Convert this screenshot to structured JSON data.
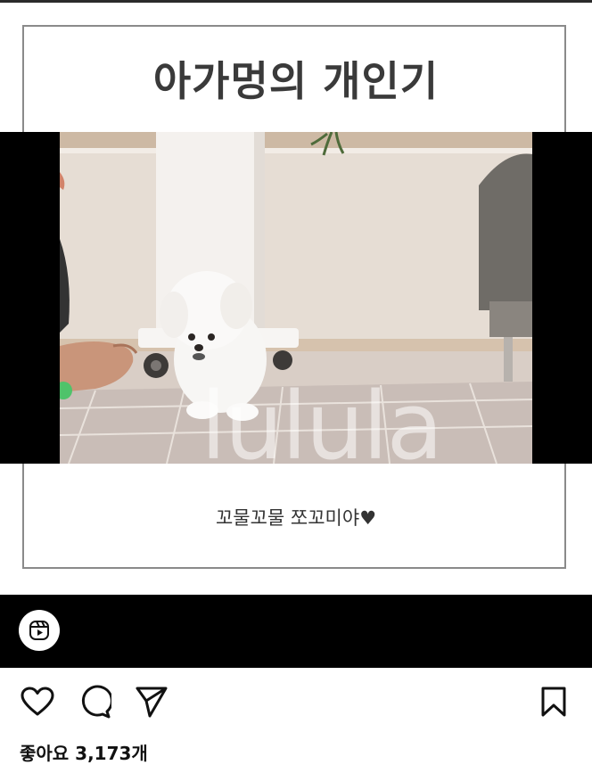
{
  "post": {
    "title": "아가멍의 개인기",
    "caption": "꼬물꼬물 쪼꼬미야",
    "heart": "♥",
    "watermark": "lulula"
  },
  "reel_bar": {
    "icon": "reels-icon"
  },
  "actions": {
    "like_icon": "heart-icon",
    "comment_icon": "comment-icon",
    "share_icon": "send-icon",
    "save_icon": "bookmark-icon"
  },
  "likes": {
    "text": "좋아요 3,173개"
  },
  "colors": {
    "title": "#3a3a3a",
    "frame": "#8a8a8a",
    "floor": "#cfc4bd",
    "wall": "#e6ddd4"
  }
}
